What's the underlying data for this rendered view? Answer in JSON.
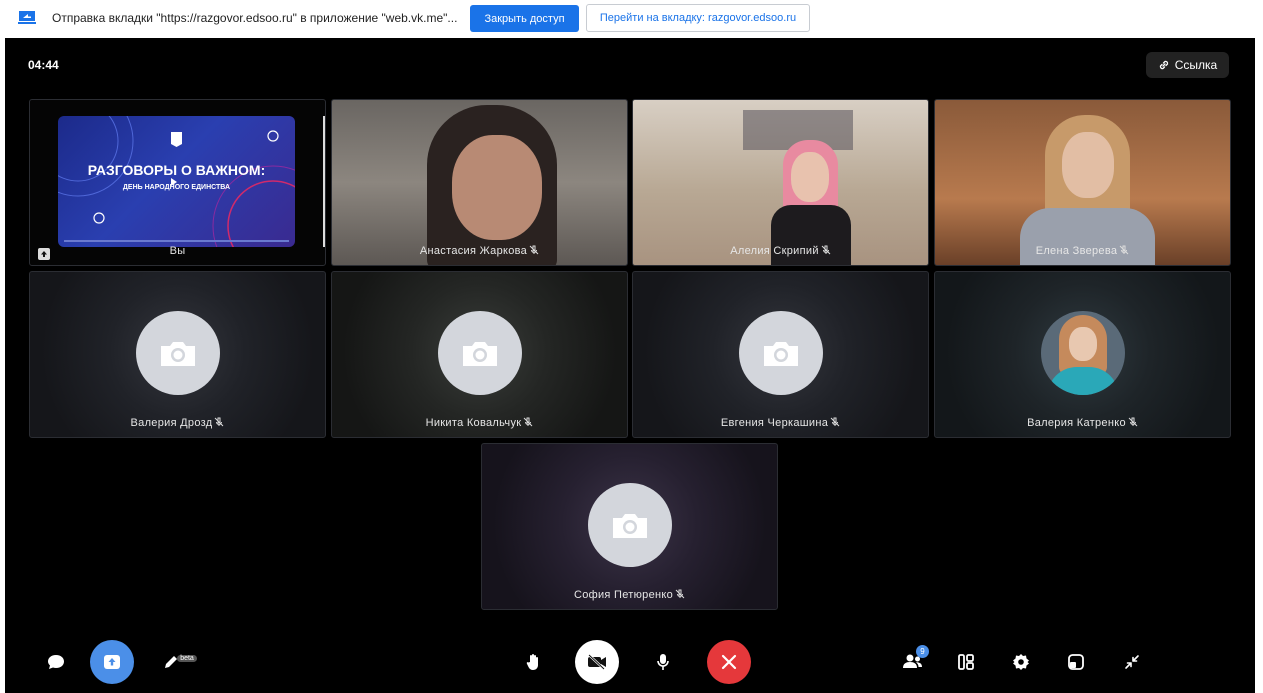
{
  "sharebar": {
    "text": "Отправка вкладки \"https://razgovor.edsoo.ru\" в приложение \"web.vk.me\"...",
    "stop_label": "Закрыть доступ",
    "goto_label": "Перейти на вкладку: razgovor.edsoo.ru"
  },
  "call": {
    "timer": "04:44",
    "link_label": "Ссылка",
    "participants_count": "9"
  },
  "slide": {
    "title": "РАЗГОВОРЫ О ВАЖНОМ:",
    "subtitle": "ДЕНЬ НАРОДНОГО ЕДИНСТВА"
  },
  "tiles": [
    {
      "name": "Вы"
    },
    {
      "name": "Анастасия Жаркова"
    },
    {
      "name": "Алелия Скрипий"
    },
    {
      "name": "Елена Зверева"
    },
    {
      "name": "Валерия Дрозд"
    },
    {
      "name": "Никита Ковальчук"
    },
    {
      "name": "Евгения Черкашина"
    },
    {
      "name": "Валерия Катренко"
    },
    {
      "name": "София Петюренко"
    }
  ],
  "controls": {
    "draw_badge": "beta"
  },
  "colors": {
    "accent": "#1a73e8",
    "share_btn": "#4b8fe8",
    "end_call": "#e5383b",
    "background": "#000000"
  }
}
